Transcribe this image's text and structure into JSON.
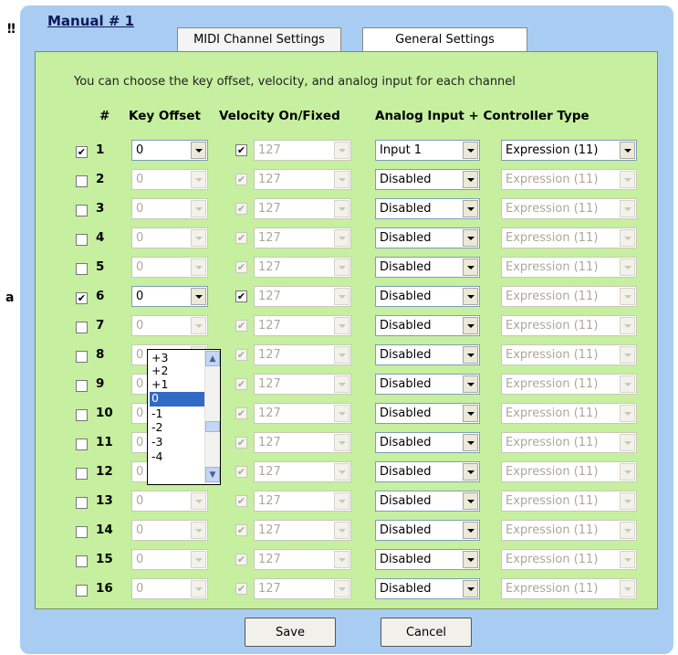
{
  "background": {
    "mark": "‼",
    "letter": "a"
  },
  "dialog": {
    "title": "Manual # 1",
    "tabs": [
      {
        "label": "MIDI Channel Settings",
        "active": true
      },
      {
        "label": "General Settings",
        "active": false
      }
    ],
    "intro": "You can choose the key offset, velocity, and analog input for each channel",
    "headers": {
      "num": "#",
      "key_offset": "Key Offset",
      "velocity": "Velocity On/Fixed",
      "analog": "Analog Input + Controller Type"
    },
    "channels": [
      {
        "num": "1",
        "enabled": true,
        "key_offset": "0",
        "velocity_on": true,
        "velocity": "127",
        "analog_input": "Input 1",
        "controller": "Expression (11)"
      },
      {
        "num": "2",
        "enabled": false,
        "key_offset": "0",
        "velocity_on": true,
        "velocity": "127",
        "analog_input": "Disabled",
        "controller": "Expression (11)"
      },
      {
        "num": "3",
        "enabled": false,
        "key_offset": "0",
        "velocity_on": true,
        "velocity": "127",
        "analog_input": "Disabled",
        "controller": "Expression (11)"
      },
      {
        "num": "4",
        "enabled": false,
        "key_offset": "0",
        "velocity_on": true,
        "velocity": "127",
        "analog_input": "Disabled",
        "controller": "Expression (11)"
      },
      {
        "num": "5",
        "enabled": false,
        "key_offset": "0",
        "velocity_on": true,
        "velocity": "127",
        "analog_input": "Disabled",
        "controller": "Expression (11)"
      },
      {
        "num": "6",
        "enabled": true,
        "key_offset": "0",
        "velocity_on": true,
        "velocity": "127",
        "analog_input": "Disabled",
        "controller": "Expression (11)"
      },
      {
        "num": "7",
        "enabled": false,
        "key_offset": "0",
        "velocity_on": true,
        "velocity": "127",
        "analog_input": "Disabled",
        "controller": "Expression (11)"
      },
      {
        "num": "8",
        "enabled": false,
        "key_offset": "0",
        "velocity_on": true,
        "velocity": "127",
        "analog_input": "Disabled",
        "controller": "Expression (11)"
      },
      {
        "num": "9",
        "enabled": false,
        "key_offset": "0",
        "velocity_on": true,
        "velocity": "127",
        "analog_input": "Disabled",
        "controller": "Expression (11)"
      },
      {
        "num": "10",
        "enabled": false,
        "key_offset": "0",
        "velocity_on": true,
        "velocity": "127",
        "analog_input": "Disabled",
        "controller": "Expression (11)"
      },
      {
        "num": "11",
        "enabled": false,
        "key_offset": "0",
        "velocity_on": true,
        "velocity": "127",
        "analog_input": "Disabled",
        "controller": "Expression (11)"
      },
      {
        "num": "12",
        "enabled": false,
        "key_offset": "0",
        "velocity_on": true,
        "velocity": "127",
        "analog_input": "Disabled",
        "controller": "Expression (11)"
      },
      {
        "num": "13",
        "enabled": false,
        "key_offset": "0",
        "velocity_on": true,
        "velocity": "127",
        "analog_input": "Disabled",
        "controller": "Expression (11)"
      },
      {
        "num": "14",
        "enabled": false,
        "key_offset": "0",
        "velocity_on": true,
        "velocity": "127",
        "analog_input": "Disabled",
        "controller": "Expression (11)"
      },
      {
        "num": "15",
        "enabled": false,
        "key_offset": "0",
        "velocity_on": true,
        "velocity": "127",
        "analog_input": "Disabled",
        "controller": "Expression (11)"
      },
      {
        "num": "16",
        "enabled": false,
        "key_offset": "0",
        "velocity_on": true,
        "velocity": "127",
        "analog_input": "Disabled",
        "controller": "Expression (11)"
      }
    ],
    "open_dropdown": {
      "channel": "6",
      "options": [
        "+3",
        "+2",
        "+1",
        "0",
        "-1",
        "-2",
        "-3",
        "-4"
      ],
      "selected": "0"
    },
    "buttons": {
      "save": "Save",
      "cancel": "Cancel"
    }
  },
  "colors": {
    "dialog_bg": "#a9cdf2",
    "panel_bg": "#c6ef9f",
    "selection": "#316ac5"
  },
  "icons": {
    "checkbox_checked": "check-mark",
    "dropdown": "chevron-down-icon",
    "scroll_up": "chevron-up-icon",
    "scroll_down": "chevron-down-icon"
  }
}
